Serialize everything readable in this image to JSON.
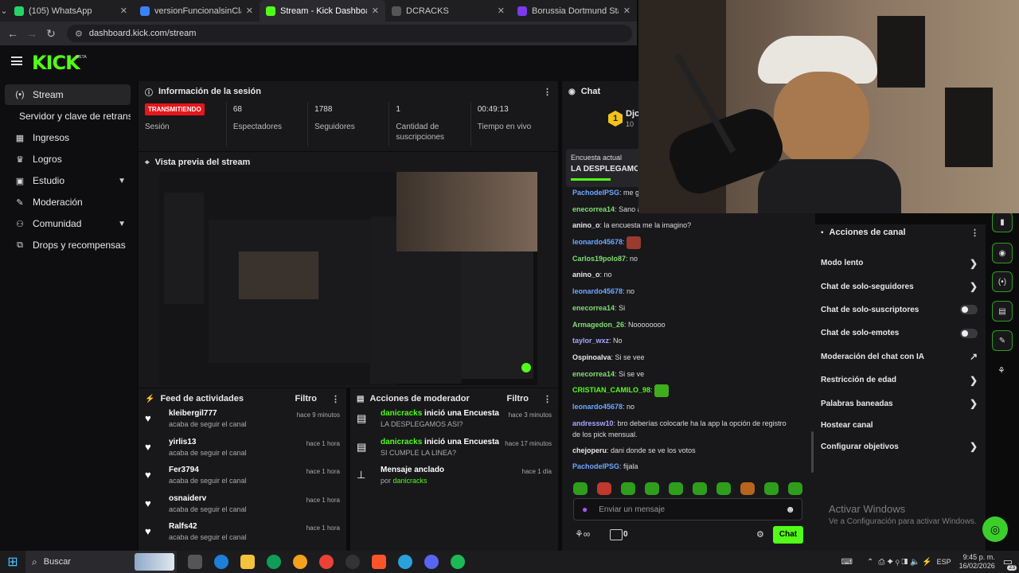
{
  "browser": {
    "tabs": [
      {
        "title": "(105) WhatsApp",
        "color": "#25d366",
        "active": false
      },
      {
        "title": "versionFuncionalsinClasificacio",
        "color": "#3b82f6",
        "active": false
      },
      {
        "title": "Stream - Kick Dashboard",
        "color": "#53fc18",
        "active": true
      },
      {
        "title": "DCRACKS",
        "color": "#555",
        "active": false
      },
      {
        "title": "Borussia Dortmund Stats - Shot",
        "color": "#7c3aed",
        "active": false
      }
    ],
    "url": "dashboard.kick.com/stream"
  },
  "kick": {
    "logo": "KICK",
    "beta": "BETA"
  },
  "sidebar": {
    "items": [
      {
        "label": "Stream",
        "icon": "broadcast-icon"
      },
      {
        "label": "Servidor y clave de retransmi",
        "icon": ""
      },
      {
        "label": "Ingresos",
        "icon": "revenue-icon"
      },
      {
        "label": "Logros",
        "icon": "trophy-icon"
      },
      {
        "label": "Estudio",
        "icon": "studio-icon"
      },
      {
        "label": "Moderación",
        "icon": "wrench-icon"
      },
      {
        "label": "Comunidad",
        "icon": "community-icon"
      },
      {
        "label": "Drops y recompensas",
        "icon": "drops-icon"
      }
    ]
  },
  "session": {
    "title": "Información de la sesión",
    "status": "TRANSMITIENDO",
    "status_label": "Sesión",
    "stats": [
      {
        "value": "68",
        "label": "Espectadores"
      },
      {
        "value": "1788",
        "label": "Seguidores"
      },
      {
        "value": "1",
        "label": "Cantidad de suscripciones"
      },
      {
        "value": "00:49:13",
        "label": "Tiempo en vivo"
      }
    ]
  },
  "preview": {
    "title": "Vista previa del stream"
  },
  "feed": {
    "title": "Feed de actividades",
    "filter": "Filtro",
    "items": [
      {
        "user": "kleibergil777",
        "text": "acaba de seguir el canal",
        "time": "hace 9 minutos"
      },
      {
        "user": "yirlis13",
        "text": "acaba de seguir el canal",
        "time": "hace 1 hora"
      },
      {
        "user": "Fer3794",
        "text": "acaba de seguir el canal",
        "time": "hace 1 hora"
      },
      {
        "user": "osnaiderv",
        "text": "acaba de seguir el canal",
        "time": "hace 1 hora"
      },
      {
        "user": "Ralfs42",
        "text": "acaba de seguir el canal",
        "time": "hace 1 hora"
      }
    ]
  },
  "modactions": {
    "title": "Acciones de moderador",
    "filter": "Filtro",
    "items": [
      {
        "user": "danicracks",
        "action": "inició una Encuesta",
        "detail": "LA DESPLEGAMOS ASI?",
        "time": "hace 3 minutos"
      },
      {
        "user": "danicracks",
        "action": "inició una Encuesta",
        "detail": "SI CUMPLE LA LINEA?",
        "time": "hace 17 minutos"
      },
      {
        "user": "",
        "action": "Mensaje anclado",
        "detail": "por",
        "detail_user": "danicracks",
        "time": "hace 1 día"
      }
    ]
  },
  "chat": {
    "title": "Chat",
    "leader_rank": "1",
    "leader_name": "Djc",
    "leader_sub": "10",
    "poll_label": "Encuesta actual",
    "poll_question": "LA DESPLEGAMO",
    "messages": [
      {
        "user": "PachodelPSG",
        "color": "#6ea8ff",
        "text": "me g"
      },
      {
        "user": "enecorrea14",
        "color": "#7ee06f",
        "text": "Sano a"
      },
      {
        "user": "anino_o",
        "color": "#e8e8e8",
        "text": "la encuesta me la imagino?"
      },
      {
        "user": "leonardo45678",
        "color": "#6ea8ff",
        "text": "[emote]"
      },
      {
        "user": "Carlos19polo87",
        "color": "#7ee06f",
        "text": "no"
      },
      {
        "user": "anino_o",
        "color": "#e8e8e8",
        "text": "no"
      },
      {
        "user": "leonardo45678",
        "color": "#6ea8ff",
        "text": "no"
      },
      {
        "user": "enecorrea14",
        "color": "#7ee06f",
        "text": "Si"
      },
      {
        "user": "Armagedon_26",
        "color": "#7ee06f",
        "text": "Noooooooo"
      },
      {
        "user": "taylor_wxz",
        "color": "#a6a6ff",
        "text": "No"
      },
      {
        "user": "Ospinoalva",
        "color": "#e8e8e8",
        "text": "Si se vee"
      },
      {
        "user": "enecorrea14",
        "color": "#7ee06f",
        "text": "Si se ve"
      },
      {
        "user": "CRISTIAN_CAMILO_98",
        "color": "#53fc18",
        "text": "[emote]"
      },
      {
        "user": "leonardo45678",
        "color": "#6ea8ff",
        "text": "no"
      },
      {
        "user": "andressw10",
        "color": "#a6a6ff",
        "text": "bro deberías colocarle ha la app la opción de registro de los pick mensual."
      },
      {
        "user": "chejoperu",
        "color": "#e8e8e8",
        "text": "dani donde se ve los votos"
      },
      {
        "user": "PachodelPSG",
        "color": "#6ea8ff",
        "text": "fijala"
      }
    ],
    "input_placeholder": "Enviar un mensaje",
    "points": "0",
    "send_label": "Chat"
  },
  "channel_actions": {
    "title": "Acciones de canal",
    "items": [
      {
        "label": "Modo lento",
        "control": "chevron"
      },
      {
        "label": "Chat de solo-seguidores",
        "control": "chevron"
      },
      {
        "label": "Chat de solo-suscriptores",
        "control": "toggle"
      },
      {
        "label": "Chat de solo-emotes",
        "control": "toggle"
      },
      {
        "label": "Moderación del chat con IA",
        "control": "external"
      },
      {
        "label": "Restricción de edad",
        "control": "chevron"
      },
      {
        "label": "Palabras baneadas",
        "control": "chevron"
      },
      {
        "label": "Hostear canal",
        "control": "none"
      },
      {
        "label": "Configurar objetivos",
        "control": "chevron"
      }
    ]
  },
  "windows": {
    "activate_title": "Activar Windows",
    "activate_sub": "Ve a Configuración para activar Windows.",
    "search": "Buscar",
    "lang": "ESP",
    "time": "9:45 p. m.",
    "date": "16/02/2026",
    "notif": "23"
  }
}
